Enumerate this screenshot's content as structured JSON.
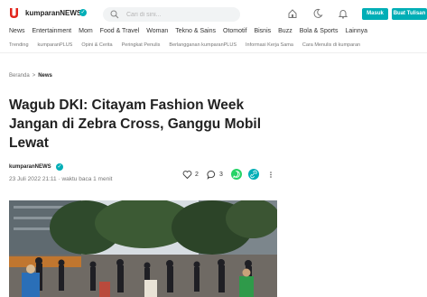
{
  "header": {
    "logo_text": "kumparanNEWS",
    "search": {
      "placeholder": "Cari di sini..."
    },
    "login_label": "Masuk",
    "register_label": "Buat Tulisan",
    "icons": [
      "home-icon",
      "moon-icon",
      "bell-icon"
    ]
  },
  "nav": {
    "items": [
      "News",
      "Entertainment",
      "Mom",
      "Food & Travel",
      "Woman",
      "Tekno & Sains",
      "Otomotif",
      "Bisnis",
      "Buzz",
      "Bola & Sports",
      "Lainnya"
    ]
  },
  "subnav": {
    "items": [
      "Trending",
      "kumparanPLUS",
      "Opini & Cerita",
      "Peringkat Penulis",
      "Berlangganan kumparanPLUS",
      "Informasi Kerja Sama",
      "Cara Menulis di kumparan"
    ]
  },
  "breadcrumb": {
    "home": "Beranda",
    "separator": ">",
    "current": "News"
  },
  "article": {
    "title": "Wagub DKI: Citayam Fashion Week Jangan di Zebra Cross, Ganggu Mobil Lewat",
    "author": "kumparanNEWS",
    "date": "23 Juli 2022 21:11",
    "read_time": "· waktu baca 1 menit",
    "likes": "2",
    "comments": "3"
  },
  "colors": {
    "accent": "#00aeb6",
    "whatsapp": "#25d366",
    "brand_red": "#e2231a"
  }
}
